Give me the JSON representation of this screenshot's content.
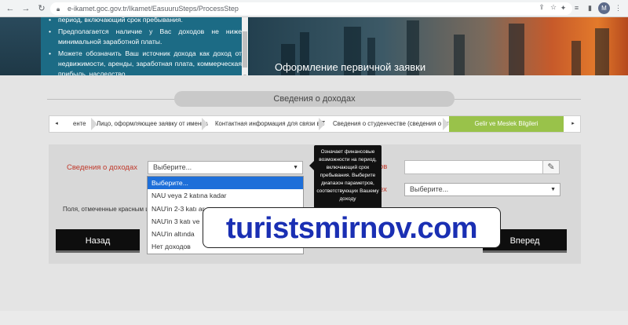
{
  "browser": {
    "url": "e-ikamet.goc.gov.tr/Ikamet/EasuuruSteps/ProcessStep",
    "profile_initial": "M"
  },
  "info_box": {
    "items": [
      "период, включающий срок пребывания.",
      "Предполагается наличие у Вас доходов не ниже минимальной заработной платы.",
      "Можете обозначить Ваш источник дохода как доход от недвижимости, аренды, заработная плата, коммерческая прибыль, наследство,"
    ]
  },
  "banner": {
    "caption": "Оформление первичной заявки"
  },
  "section": {
    "title": "Сведения о доходах"
  },
  "steps": {
    "prev_label": "◂",
    "next_label": "▸",
    "items": [
      "енте",
      "Лицо, оформляющее заявку от имени и",
      "Контактная информация для связи в Ту",
      "Сведения о студенчестве (сведения о ст",
      "Gelir ve Meslek Bilgileri"
    ]
  },
  "form": {
    "income_label": "Сведения о доходах",
    "income_select_value": "Выберите...",
    "right_label_1": "ов",
    "right_label_2": "ех",
    "right_select_value": "Выберите...",
    "required_note": "Поля, отмеченные красным ц",
    "dropdown_options": [
      "Выберите...",
      "NAU veya 2 katına kadar",
      "NAU'in 2-3 katı ar",
      "NAU'in 3 katı ve",
      "NAU'in altında",
      "Нет доходов"
    ]
  },
  "tooltip": {
    "text": "Означает финансовые возможности на период, включающий срок пребывания. Выберите диапазон параметров, соответствующих Вашему доходу"
  },
  "buttons": {
    "back": "Назад",
    "next": "Вперед"
  },
  "watermark": "turistsmirnov.com"
}
